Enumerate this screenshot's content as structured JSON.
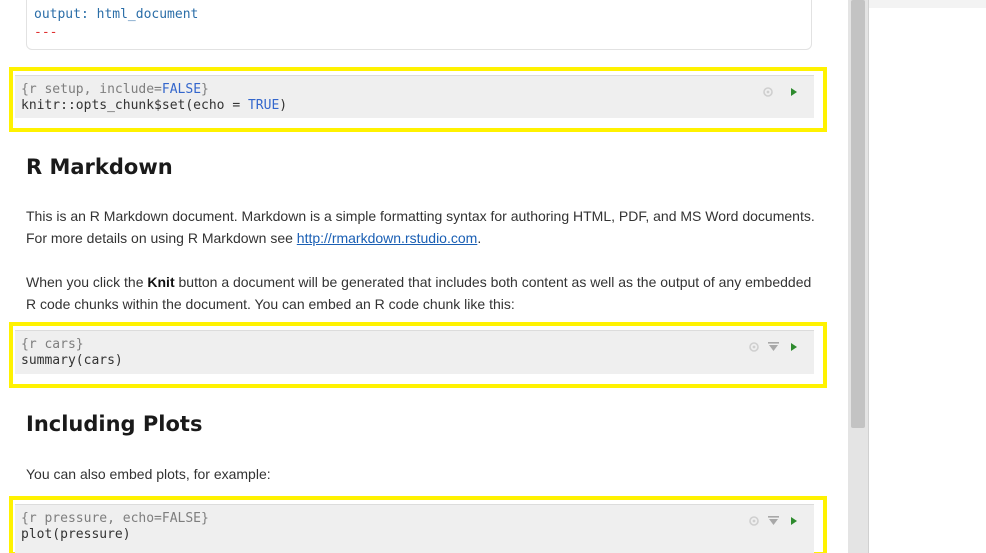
{
  "yaml": {
    "output_line": "output: html_document",
    "end_marker": "---"
  },
  "chunks": [
    {
      "header": "{r setup, include=",
      "header_kw": "FALSE",
      "header_end": "}",
      "code": "knitr::opts_chunk$set(echo = ",
      "code_kw": "TRUE",
      "code_end": ")"
    },
    {
      "header": "{r cars}",
      "code": "summary(cars)"
    },
    {
      "header": "{r pressure, echo=FALSE}",
      "code": "plot(pressure)"
    }
  ],
  "sections": [
    {
      "heading": "R Markdown"
    },
    {
      "heading": "Including Plots"
    }
  ],
  "paragraphs": {
    "p1_text": "This is an R Markdown document. Markdown is a simple formatting syntax for authoring HTML, PDF, and MS Word documents. For more details on using R Markdown see ",
    "p1_link": "http://rmarkdown.rstudio.com",
    "p1_end": ".",
    "p2_before": "When you click the ",
    "p2_bold": "Knit",
    "p2_after": " button a document will be generated that includes both content as well as the output of any embedded R code chunks within the document. You can embed an R code chunk like this:",
    "p3": "You can also embed plots, for example:"
  },
  "colors": {
    "highlight": "#fff200",
    "chunk_bg": "#efefef",
    "run_arrow": "#2e8b2e"
  },
  "icons": [
    "gear-icon",
    "run-previous-chunks-icon",
    "run-chunk-icon"
  ]
}
